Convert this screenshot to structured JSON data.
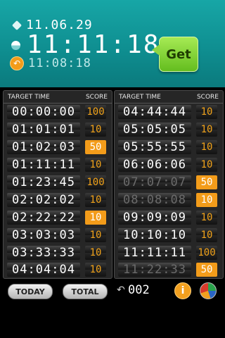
{
  "header": {
    "date": "11.06.29",
    "current_time": "11:11:18",
    "last_time": "11:08:18",
    "get_label": "Get",
    "icons": {
      "date": "diamond-icon",
      "clock": "half-circle-icon",
      "last": "undo-badge-icon"
    }
  },
  "table": {
    "col_time": "TARGET TIME",
    "col_score": "SCORE",
    "left_rows": [
      {
        "time": "00:00:00",
        "score": "100"
      },
      {
        "time": "01:01:01",
        "score": "10"
      },
      {
        "time": "01:02:03",
        "score": "50"
      },
      {
        "time": "01:11:11",
        "score": "10"
      },
      {
        "time": "01:23:45",
        "score": "100"
      },
      {
        "time": "02:02:02",
        "score": "10"
      },
      {
        "time": "02:22:22",
        "score": "10"
      },
      {
        "time": "03:03:03",
        "score": "10"
      },
      {
        "time": "03:33:33",
        "score": "10"
      },
      {
        "time": "04:04:04",
        "score": "10"
      }
    ],
    "right_rows": [
      {
        "time": "04:44:44",
        "score": "10"
      },
      {
        "time": "05:05:05",
        "score": "10"
      },
      {
        "time": "05:55:55",
        "score": "10"
      },
      {
        "time": "06:06:06",
        "score": "10"
      },
      {
        "time": "07:07:07",
        "score": "50"
      },
      {
        "time": "08:08:08",
        "score": "10"
      },
      {
        "time": "09:09:09",
        "score": "10"
      },
      {
        "time": "10:10:10",
        "score": "10"
      },
      {
        "time": "11:11:11",
        "score": "100"
      },
      {
        "time": "11:22:33",
        "score": "50"
      }
    ]
  },
  "footer": {
    "today_label": "TODAY",
    "total_label": "TOTAL",
    "undo_symbol": "↶",
    "count": "002",
    "info_symbol": "i",
    "icons": {
      "undo": "undo-icon",
      "info": "info-icon",
      "stats": "pie-chart-icon"
    }
  },
  "colors": {
    "teal": "#129a9b",
    "orange": "#f39c1a",
    "green_button": "#7fd33a"
  }
}
